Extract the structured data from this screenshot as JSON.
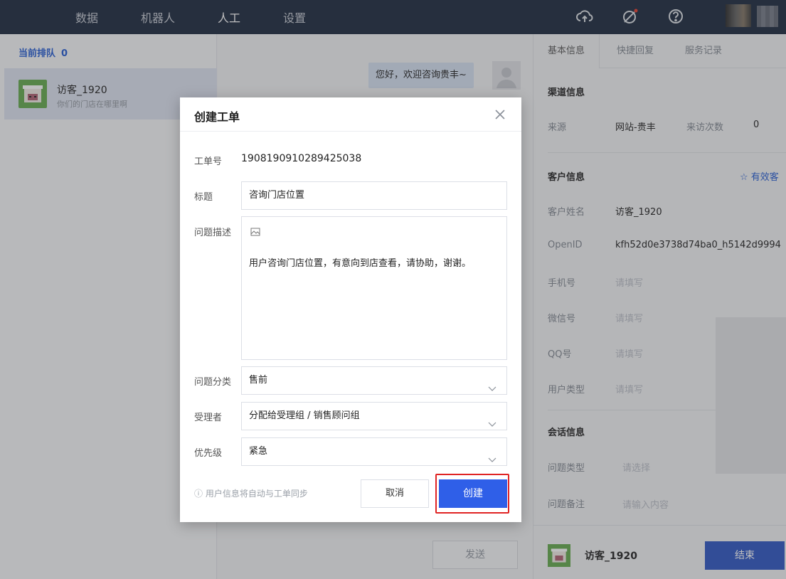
{
  "nav": {
    "items": [
      "数据",
      "机器人",
      "人工",
      "设置"
    ],
    "active_index": 2,
    "icons": [
      "cloud-upload-icon",
      "no-signal-icon",
      "help-icon"
    ]
  },
  "queue": {
    "title": "当前排队",
    "count": "0",
    "visitor_name": "访客_1920",
    "visitor_preview": "你们的门店在哪里啊"
  },
  "chat": {
    "greeting": "您好，欢迎咨询贵丰~",
    "send_label": "发送"
  },
  "right_panel": {
    "tabs": [
      "基本信息",
      "快捷回复",
      "服务记录"
    ],
    "channel_title": "渠道信息",
    "source_label": "来源",
    "source_value": "网站-贵丰",
    "visits_label": "来访次数",
    "visits_value": "0",
    "customer_title": "客户信息",
    "valid_customer": "有效客",
    "name_label": "客户姓名",
    "name_value": "访客_1920",
    "openid_label": "OpenID",
    "openid_value": "kfh52d0e3738d74ba0_h5142d9994",
    "phone_label": "手机号",
    "phone_ph": "请填写",
    "wechat_label": "微信号",
    "wechat_ph": "请填写",
    "qq_label": "QQ号",
    "qq_ph": "请填写",
    "usertype_label": "用户类型",
    "usertype_ph": "请填写",
    "session_title": "会话信息",
    "issuetype_label": "问题类型",
    "issuetype_ph": "请选择",
    "note_label": "问题备注",
    "note_ph": "请输入内容",
    "bottom_name": "访客_1920",
    "end_label": "结束"
  },
  "modal": {
    "title": "创建工单",
    "ticket_label": "工单号",
    "ticket_value": "1908190910289425038",
    "subject_label": "标题",
    "subject_value": "咨询门店位置",
    "desc_label": "问题描述",
    "desc_value": "用户咨询门店位置，有意向到店查看，请协助，谢谢。",
    "category_label": "问题分类",
    "category_value": "售前",
    "assignee_label": "受理者",
    "assignee_value": "分配给受理组 / 销售顾问组",
    "priority_label": "优先级",
    "priority_value": "紧急",
    "hint": "用户信息将自动与工单同步",
    "cancel_label": "取消",
    "create_label": "创建"
  },
  "colors": {
    "topbar": "#2d3a4d",
    "primary": "#2f5fe8",
    "highlight": "#e02424"
  }
}
